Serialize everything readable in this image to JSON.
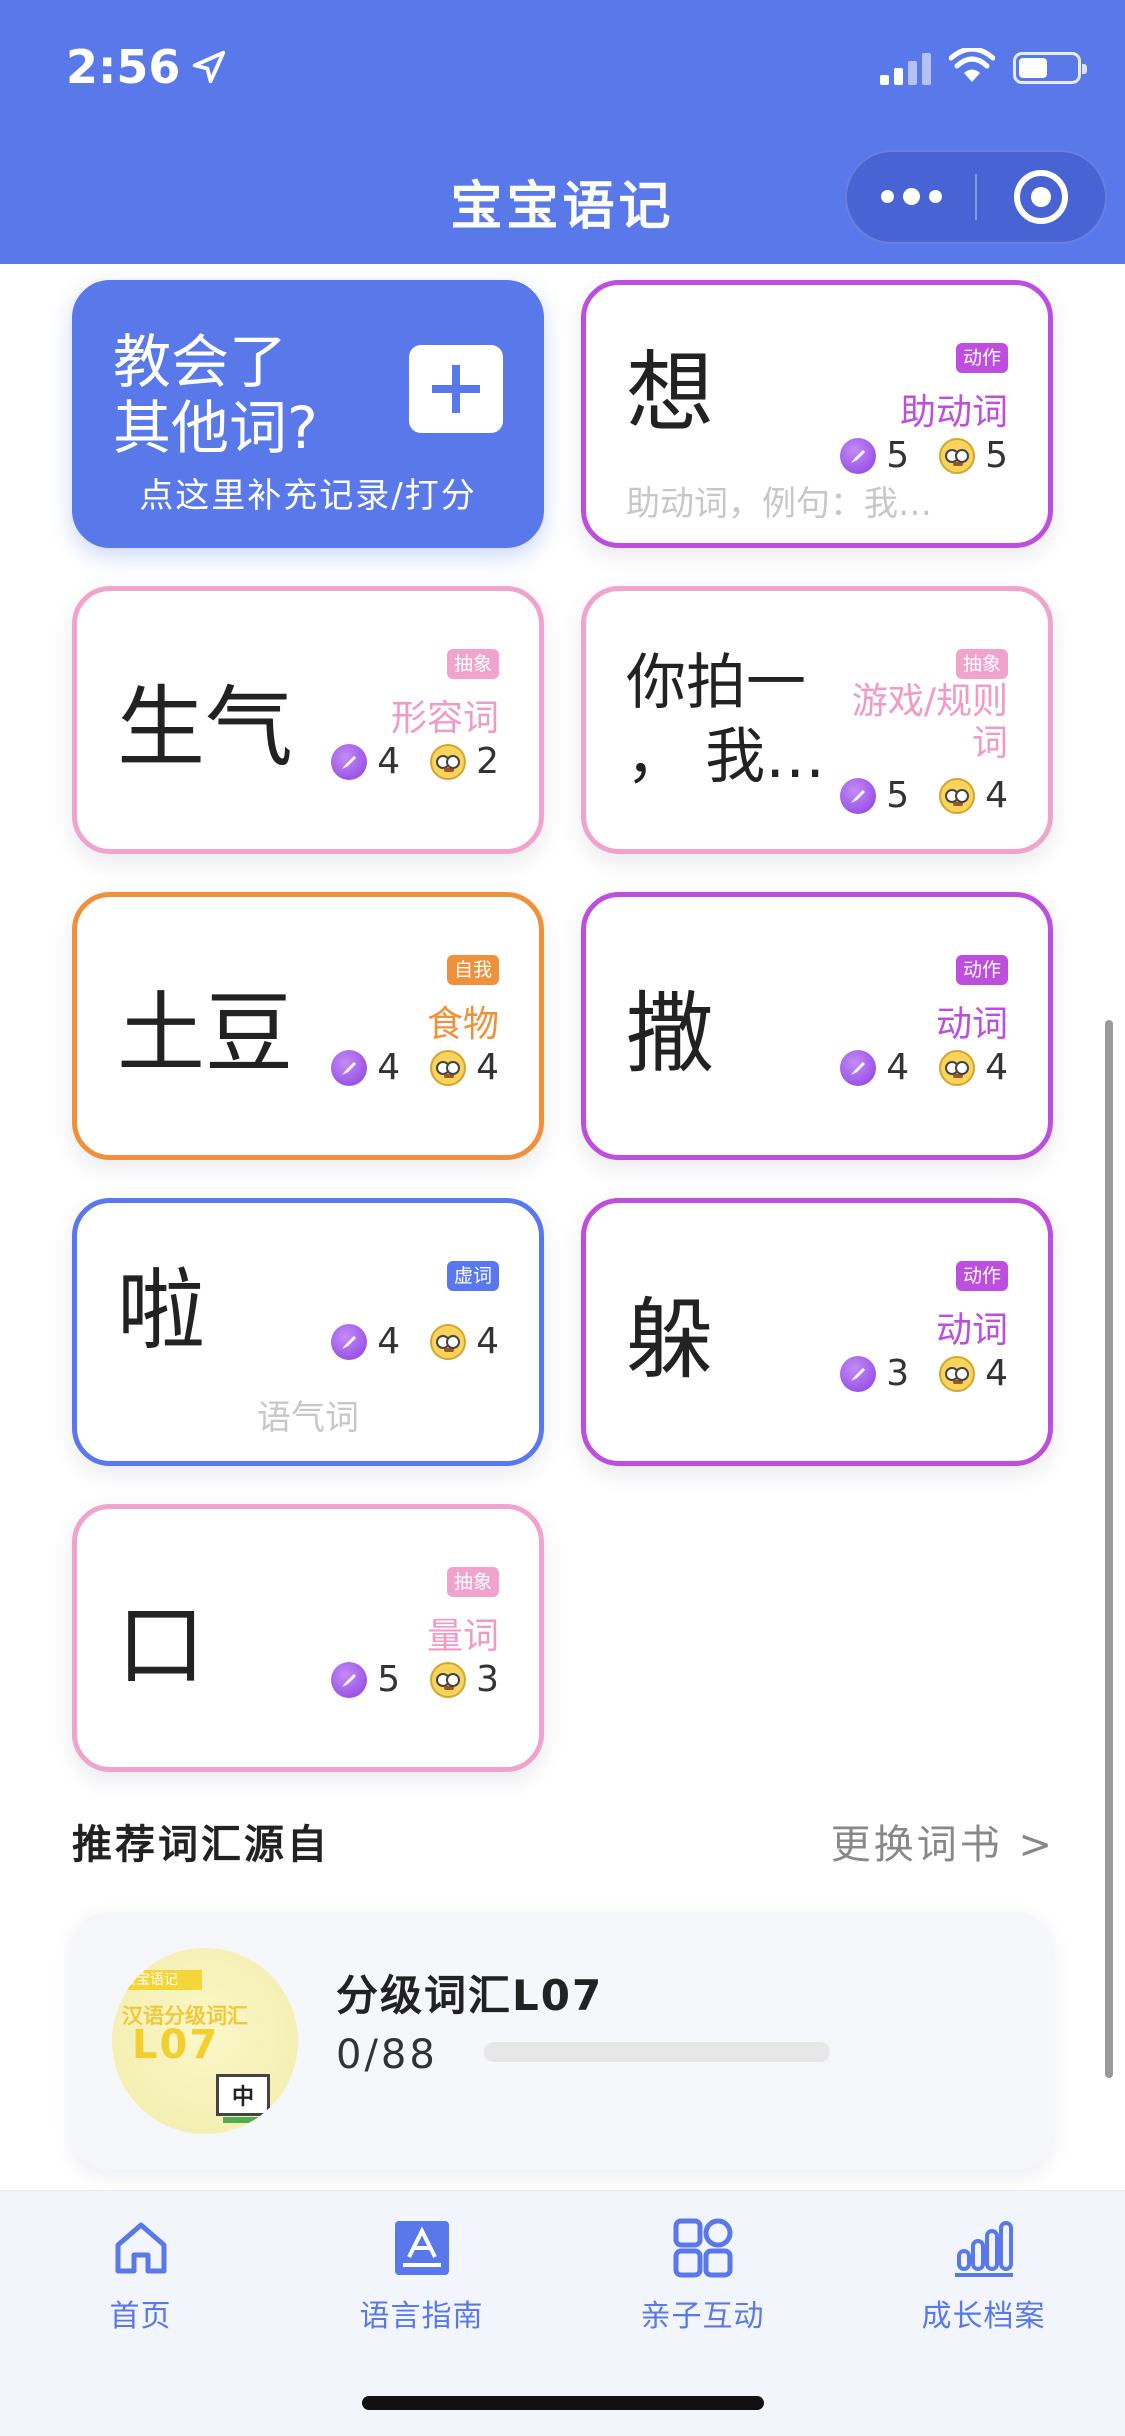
{
  "status_bar": {
    "time": "2:56"
  },
  "header": {
    "title": "宝宝语记"
  },
  "add_card": {
    "title_line1": "教会了",
    "title_line2": "其他词?",
    "subtitle": "点这里补充记录/打分"
  },
  "cards": [
    {
      "word": "想",
      "tag": "动作",
      "category": "助动词",
      "score_a": "5",
      "score_b": "5",
      "note": "助动词，例句：我…"
    },
    {
      "word": "生气",
      "tag": "抽象",
      "category": "形容词",
      "score_a": "4",
      "score_b": "2"
    },
    {
      "word_line1": "你拍一",
      "word_line2": "，  我…",
      "tag": "抽象",
      "category": "游戏/规则词",
      "score_a": "5",
      "score_b": "4"
    },
    {
      "word": "土豆",
      "tag": "自我",
      "category": "食物",
      "score_a": "4",
      "score_b": "4"
    },
    {
      "word": "撒",
      "tag": "动作",
      "category": "动词",
      "score_a": "4",
      "score_b": "4"
    },
    {
      "word": "啦",
      "tag": "虚词",
      "category": "",
      "score_a": "4",
      "score_b": "4",
      "note": "语气词"
    },
    {
      "word": "躲",
      "tag": "动作",
      "category": "动词",
      "score_a": "3",
      "score_b": "4"
    },
    {
      "word": "口",
      "tag": "抽象",
      "category": "量词",
      "score_a": "5",
      "score_b": "3"
    }
  ],
  "recommend": {
    "title": "推荐词汇源自",
    "change_label": "更换词书 >",
    "book": {
      "name": "分级词汇L07",
      "progress_text": "0/88",
      "progress_ratio": 0,
      "cover_badge": "宝宝语记",
      "cover_title": "汉语分级词汇",
      "cover_level": "L07",
      "cover_char": "中"
    }
  },
  "tabs": [
    {
      "label": "首页",
      "icon": "home-icon"
    },
    {
      "label": "语言指南",
      "icon": "letter-a-icon"
    },
    {
      "label": "亲子互动",
      "icon": "grid-icon"
    },
    {
      "label": "成长档案",
      "icon": "bar-chart-icon"
    }
  ],
  "colors": {
    "brand": "#5979ea",
    "action": "#be4fde",
    "abstract": "#f0a3cc",
    "self": "#f0903a",
    "function_word": "#5977ef"
  }
}
